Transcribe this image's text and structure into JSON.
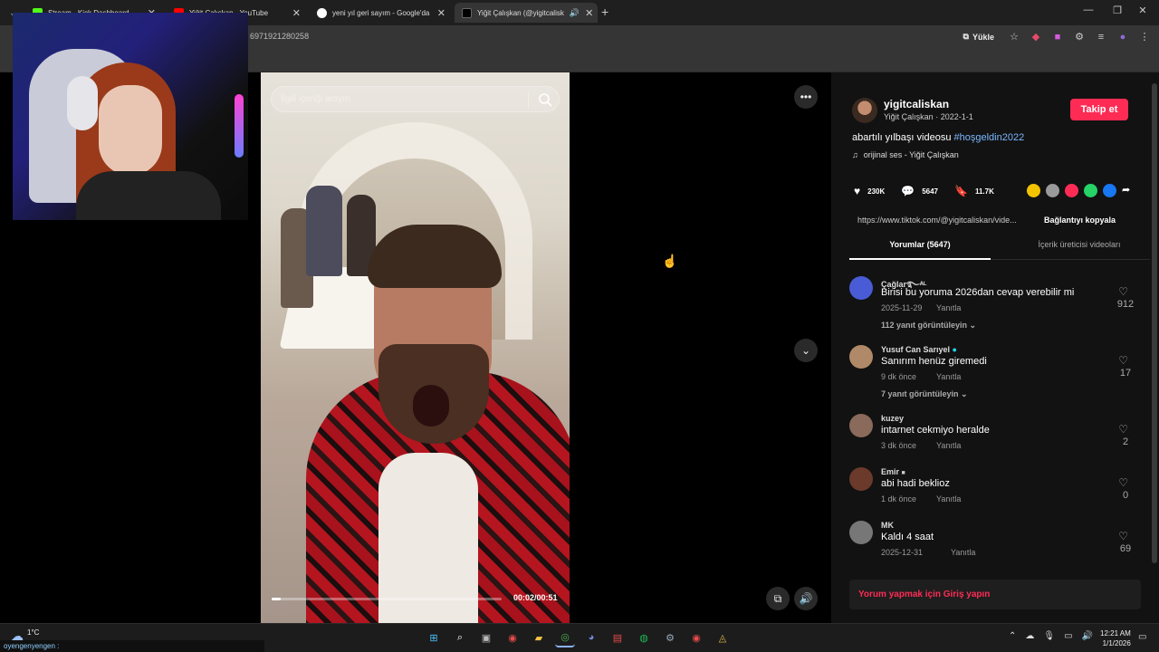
{
  "browser": {
    "tabs": [
      {
        "title": "Stream - Kick Dashboard",
        "color": "#53fc18"
      },
      {
        "title": "Yiğit Çalışkan - YouTube",
        "color": "#ff0000"
      },
      {
        "title": "yeni yıl geri sayım - Google'da",
        "color": "#4285f4"
      },
      {
        "title": "Yiğit Çalışkan (@yigitcalisk",
        "color": "#000000"
      }
    ],
    "url": "6971921280258",
    "install_label": "Yükle"
  },
  "video": {
    "search_placeholder": "İlgili içeriği arayın",
    "time": "00:02/00:51",
    "progress": 0.04
  },
  "post": {
    "author_handle": "yigitcaliskan",
    "author_sub": "Yiğit Çalışkan · 2022-1-1",
    "follow_label": "Takip et",
    "description": "abartılı yılbaşı videosu ",
    "hashtag": "#hoşgeldin2022",
    "music": "orijinal ses - Yiğit Çalışkan",
    "likes": "230K",
    "comments_count": "5647",
    "saves": "11.7K",
    "link": "https://www.tiktok.com/@yigitcaliskan/vide...",
    "copy_link": "Bağlantıyı kopyala",
    "tab_comments": "Yorumlar (5647)",
    "tab_creator": "İçerik üreticisi videoları",
    "share_colors": [
      "#f3c300",
      "#9a9a9a",
      "#fe2c55",
      "#25d366",
      "#1877f2"
    ],
    "login_prompt": "Yorum yapmak için Giriş yapın"
  },
  "comments": [
    {
      "user": "Çağlar࿐ᴬᴸ",
      "text": "Birisi bu yoruma 2026dan cevap verebilir mi",
      "date": "2025-11-29",
      "reply": "Yanıtla",
      "likes": "912",
      "more": "112 yanıt görüntüleyin",
      "avatar": "#4a5bd6"
    },
    {
      "user": "Yusuf Can Sarıyel",
      "text": "Sanırım henüz giremedi",
      "date": "9 dk önce",
      "reply": "Yanıtla",
      "likes": "17",
      "more": "7 yanıt görüntüleyin",
      "avatar": "#b08968"
    },
    {
      "user": "kuzey",
      "text": "intarnet cekmiyo heralde",
      "date": "3 dk önce",
      "reply": "Yanıtla",
      "likes": "2",
      "more": "",
      "avatar": "#8a6a5a"
    },
    {
      "user": "Emir",
      "text": "abi hadi beklioz",
      "date": "1 dk önce",
      "reply": "Yanıtla",
      "likes": "0",
      "more": "",
      "avatar": "#6b3a2a"
    },
    {
      "user": "MK",
      "text": "Kaldı 4 saat",
      "date": "2025-12-31",
      "reply": "Yanıtla",
      "likes": "69",
      "more": "",
      "avatar": "#777777"
    }
  ],
  "taskbar": {
    "temp": "1°C",
    "ticker": "oyengenyengen :",
    "time": "12:21 AM",
    "date": "1/1/2026"
  }
}
